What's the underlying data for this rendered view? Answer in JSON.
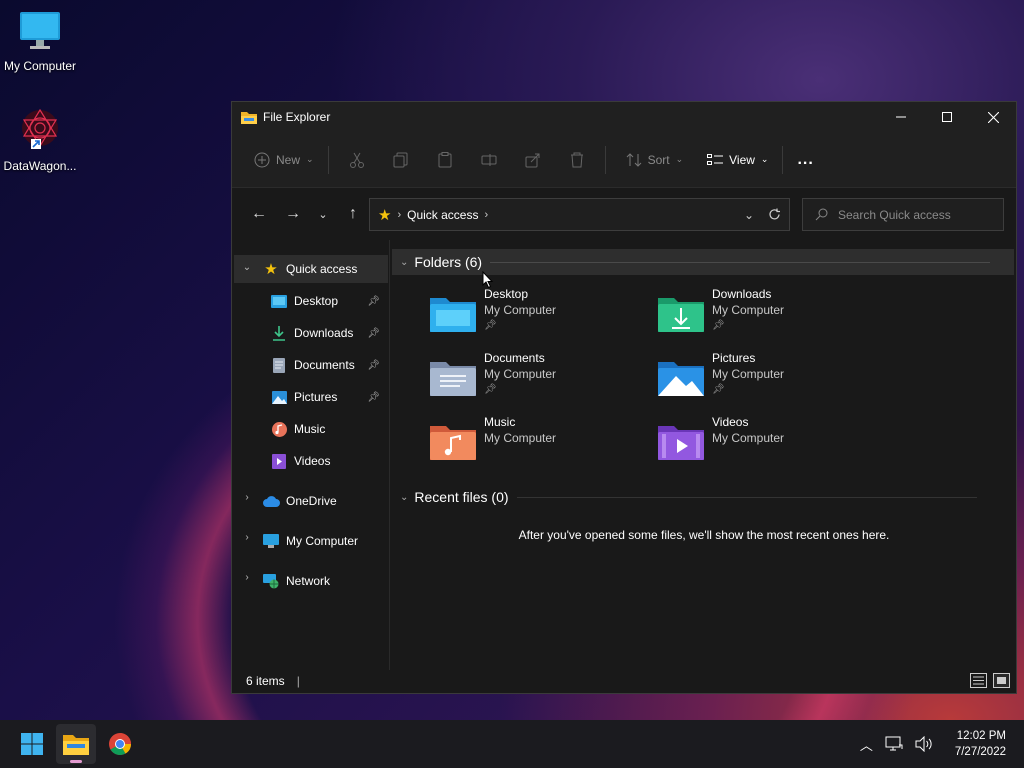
{
  "desktop": {
    "icons": [
      {
        "label": "My Computer",
        "icon": "monitor-icon"
      },
      {
        "label": "DataWagon...",
        "icon": "datawagon-shortcut-icon"
      }
    ]
  },
  "window": {
    "title": "File Explorer",
    "controls": {
      "minimize": "minimize-icon",
      "maximize": "maximize-icon",
      "close": "close-icon"
    }
  },
  "toolbar": {
    "new_label": "New",
    "sort_label": "Sort",
    "view_label": "View",
    "more_label": "...",
    "icons": [
      "cut-icon",
      "copy-icon",
      "paste-icon",
      "rename-icon",
      "share-icon",
      "delete-icon"
    ]
  },
  "address": {
    "crumb": "Quick access",
    "search_placeholder": "Search Quick access"
  },
  "sidebar": {
    "quick_access": "Quick access",
    "items": [
      {
        "label": "Desktop",
        "pinned": true
      },
      {
        "label": "Downloads",
        "pinned": true
      },
      {
        "label": "Documents",
        "pinned": true
      },
      {
        "label": "Pictures",
        "pinned": true
      },
      {
        "label": "Music",
        "pinned": false
      },
      {
        "label": "Videos",
        "pinned": false
      }
    ],
    "roots": [
      {
        "label": "OneDrive"
      },
      {
        "label": "My Computer"
      },
      {
        "label": "Network"
      }
    ]
  },
  "content": {
    "folders_header": "Folders (6)",
    "recent_header": "Recent files (0)",
    "empty_message": "After you've opened some files, we'll show the most recent ones here.",
    "folders": [
      {
        "name": "Desktop",
        "location": "My Computer",
        "pinned": true
      },
      {
        "name": "Downloads",
        "location": "My Computer",
        "pinned": true
      },
      {
        "name": "Documents",
        "location": "My Computer",
        "pinned": true
      },
      {
        "name": "Pictures",
        "location": "My Computer",
        "pinned": true
      },
      {
        "name": "Music",
        "location": "My Computer",
        "pinned": false
      },
      {
        "name": "Videos",
        "location": "My Computer",
        "pinned": false
      }
    ]
  },
  "status": {
    "items_count": "6 items"
  },
  "taskbar": {
    "apps": [
      "start-icon",
      "file-explorer-icon",
      "chrome-icon"
    ],
    "time": "12:02 PM",
    "date": "7/27/2022"
  },
  "colors": {
    "accent": "#e39bd0",
    "window_bg": "#191919",
    "toolbar_bg": "#202020"
  }
}
